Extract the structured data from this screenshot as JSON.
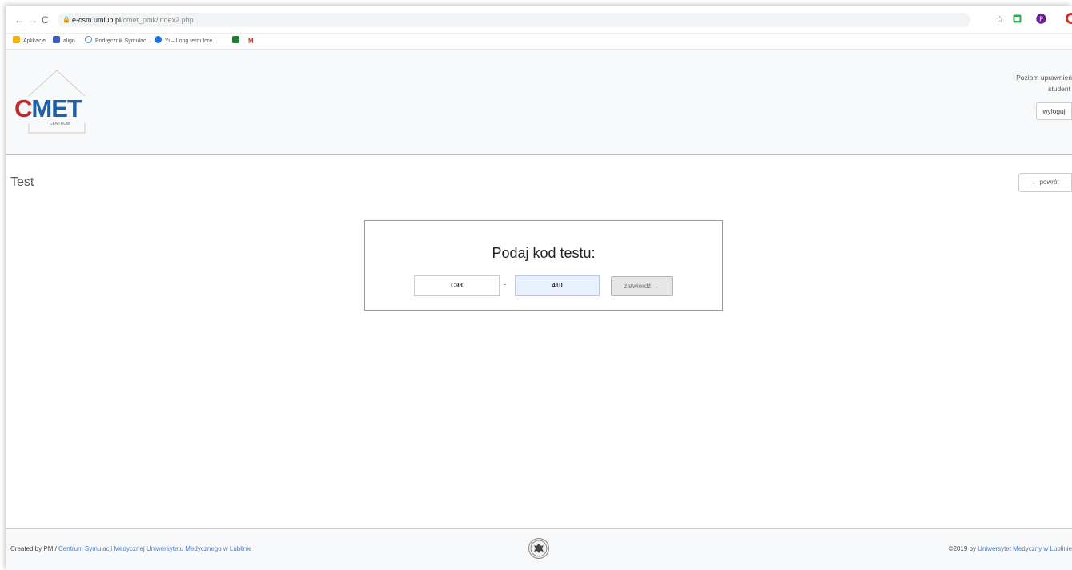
{
  "browser": {
    "back": "←",
    "forward": "→",
    "reload": "C",
    "url_host": "e-csm.umlub.pl",
    "url_path": "/cmet_pmk/index2.php",
    "bookmarks": [
      {
        "label": "Aplikacje",
        "color": "#f4b400"
      },
      {
        "label": "align",
        "color": "#3b5bbf"
      },
      {
        "label": "Podręcznik Symulac...",
        "color": "#4a90d9"
      },
      {
        "label": "Yi – Long term fore...",
        "color": "#1a73e8"
      },
      {
        "label": "",
        "color": "#1e7e34"
      },
      {
        "label": "M",
        "color": "#d93025"
      }
    ],
    "star_icon": "☆"
  },
  "header": {
    "logo_c": "C",
    "logo_met": "MET",
    "logo_sub": "CENTRUM",
    "permission_line1": "Poziom uprawnień",
    "permission_line2": "student",
    "logout": "wyloguj"
  },
  "page": {
    "title": "Test",
    "back": "← powrót"
  },
  "test_form": {
    "heading": "Podaj kod testu:",
    "code_part1": "C98",
    "separator": "-",
    "code_part2": "410",
    "submit": "zatwierdź →"
  },
  "footer": {
    "created_by": "Created by PM / ",
    "created_link": "Centrum Symulacji Medycznej Uniwersytetu Medycznego w Lublinie",
    "copyright": "©2019 by ",
    "copyright_link": "Uniwersytet Medyczny w Lublinie"
  }
}
